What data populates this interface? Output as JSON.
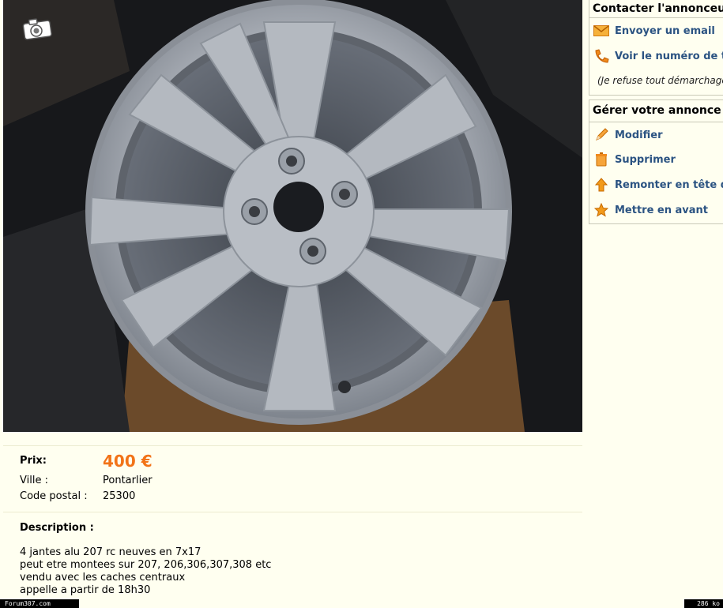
{
  "listing": {
    "price_label": "Prix:",
    "price": "400 €",
    "city_label": "Ville :",
    "city": "Pontarlier",
    "postal_label": "Code postal :",
    "postal": "25300",
    "description_label": "Description :",
    "description_lines": [
      "4 jantes alu 207 rc neuves en 7x17",
      "peut etre montees sur 207, 206,306,307,308 etc",
      "vendu avec les caches centraux",
      "appelle a partir de 18h30"
    ]
  },
  "contact": {
    "title": "Contacter l'annonceur",
    "email_label": "Envoyer un email",
    "phone_label": "Voir le numéro de t",
    "note": "(Je refuse tout démarchage"
  },
  "manage": {
    "title": "Gérer votre annonce",
    "edit_label": "Modifier",
    "delete_label": "Supprimer",
    "bump_label": "Remonter en tête d",
    "feature_label": "Mettre en avant"
  },
  "footer": {
    "watermark": "Forum307.com",
    "size": "286 ko"
  },
  "colors": {
    "price": "#f27318",
    "link": "#2b5382",
    "background": "#fffff0"
  },
  "icons": [
    "camera-icon",
    "envelope-icon",
    "phone-icon",
    "pencil-icon",
    "trash-icon",
    "arrow-up-icon",
    "star-icon"
  ]
}
